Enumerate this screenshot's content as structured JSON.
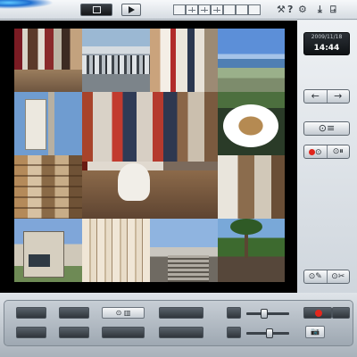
{
  "topbar": {
    "icons": [
      "monitor-icon",
      "play-icon",
      "layout-1-icon",
      "layout-4-icon",
      "layout-9-icon",
      "layout-16-icon",
      "zoom-icon",
      "snapshot-icon",
      "fullscreen-icon",
      "tools-icon",
      "help-icon",
      "setup-icon",
      "download-icon",
      "exit-icon"
    ],
    "help_glyph": "?"
  },
  "clock": {
    "date": "2009/11/18",
    "time": "14:44"
  },
  "cameras": [
    "camera-1",
    "camera-2",
    "camera-3",
    "camera-4",
    "camera-5",
    "camera-6",
    "camera-7",
    "camera-8",
    "camera-9",
    "camera-10",
    "camera-11",
    "camera-12"
  ],
  "right_panel": {
    "prev_label": "←",
    "next_label": "→"
  },
  "colors": {
    "record_red": "#e0251c",
    "viewer_bg": "#000000",
    "panel_light": "#eef1f4"
  }
}
